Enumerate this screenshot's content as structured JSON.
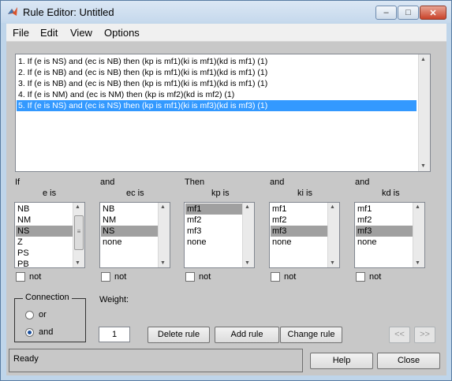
{
  "window": {
    "title": "Rule Editor: Untitled",
    "buttons": {
      "minimize": "–",
      "maximize": "□",
      "close": "✕"
    }
  },
  "menu": [
    "File",
    "Edit",
    "View",
    "Options"
  ],
  "rules": [
    "1. If (e is NS) and (ec is NB) then (kp is mf1)(ki is mf1)(kd is mf1) (1)",
    "2. If (e is NB) and (ec is NB) then (kp is mf1)(ki is mf1)(kd is mf1) (1)",
    "3. If (e is NB) and (ec is NB) then (kp is mf1)(ki is mf1)(kd is mf1) (1)",
    "4. If (e is NM) and (ec is NM) then (kp is mf2)(kd is mf2) (1)",
    "5. If (e is NS) and (ec is NS) then (kp is mf1)(ki is mf3)(kd is mf3) (1)"
  ],
  "selected_rule_index": 4,
  "columns": [
    {
      "connector": "If",
      "label": "e is",
      "items": [
        "NB",
        "NM",
        "NS",
        "Z",
        "PS",
        "PB"
      ],
      "selected": "NS",
      "not_label": "not",
      "scroll_thumb": "≡"
    },
    {
      "connector": "and",
      "label": "ec is",
      "items": [
        "NB",
        "NM",
        "NS",
        "none"
      ],
      "selected": "NS",
      "not_label": "not"
    },
    {
      "connector": "Then",
      "label": "kp is",
      "items": [
        "mf1",
        "mf2",
        "mf3",
        "none"
      ],
      "selected": "mf1",
      "not_label": "not"
    },
    {
      "connector": "and",
      "label": "ki is",
      "items": [
        "mf1",
        "mf2",
        "mf3",
        "none"
      ],
      "selected": "mf3",
      "not_label": "not"
    },
    {
      "connector": "and",
      "label": "kd is",
      "items": [
        "mf1",
        "mf2",
        "mf3",
        "none"
      ],
      "selected": "mf3",
      "not_label": "not"
    }
  ],
  "connection": {
    "title": "Connection",
    "options": [
      "or",
      "and"
    ],
    "selected": "and"
  },
  "weight": {
    "label": "Weight:",
    "value": "1"
  },
  "buttons": {
    "delete_rule": "Delete rule",
    "add_rule": "Add rule",
    "change_rule": "Change rule",
    "prev": "<<",
    "next": ">>",
    "help": "Help",
    "close": "Close"
  },
  "status": "Ready",
  "colors": {
    "selection": "#3399ff",
    "client_bg": "#c8c8c8",
    "item_highlight": "#a0a0a0"
  }
}
